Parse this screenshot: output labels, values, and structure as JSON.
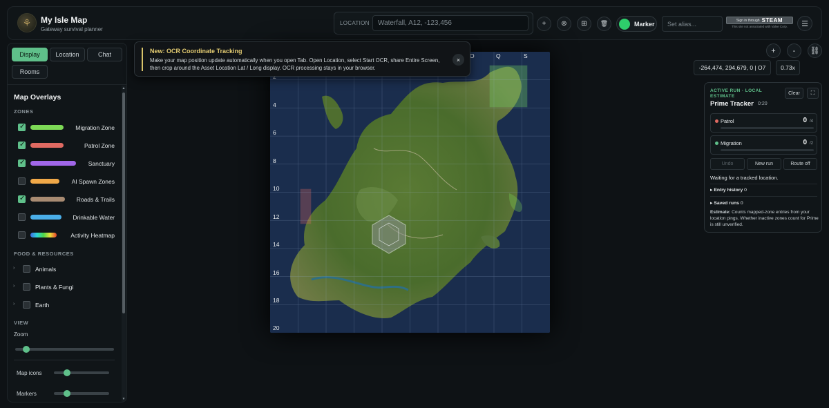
{
  "header": {
    "logo_icon": "antler-crest-icon",
    "title": "My Isle Map",
    "subtitle": "Gateway survival planner",
    "location_label": "LOCATION",
    "location_placeholder": "Waterfall, A12, -123,456",
    "buttons": {
      "add": "+",
      "ocr": "⊚",
      "grid": "⊞",
      "trash": "🗑"
    },
    "marker_label": "Marker",
    "marker_on": true,
    "alias_placeholder": "Set alias...",
    "steam_small": "Sign in through",
    "steam_big": "STEAM",
    "steam_note": "This site not associated with Valve Corp.",
    "menu_icon": "☰"
  },
  "sidebar": {
    "tabs": [
      "Display",
      "Location",
      "Chat",
      "Rooms"
    ],
    "active_tab": "Display",
    "heading": "Map Overlays",
    "zones_heading": "ZONES",
    "overlays": [
      {
        "label": "Migration Zone",
        "checked": true,
        "color": "#7dd956"
      },
      {
        "label": "Patrol Zone",
        "checked": true,
        "color": "#e06a62"
      },
      {
        "label": "Sanctuary",
        "checked": true,
        "color": "#a066e8"
      },
      {
        "label": "AI Spawn Zones",
        "checked": false,
        "color": "#f0a848"
      },
      {
        "label": "Roads & Trails",
        "checked": true,
        "color": "#a88b72"
      },
      {
        "label": "Drinkable Water",
        "checked": false,
        "color": "#4aaee8"
      },
      {
        "label": "Activity Heatmap",
        "checked": false,
        "color": "rainbow"
      }
    ],
    "food_heading": "FOOD & RESOURCES",
    "food": [
      {
        "label": "Animals",
        "checked": false
      },
      {
        "label": "Plants & Fungi",
        "checked": false
      },
      {
        "label": "Earth",
        "checked": false
      }
    ],
    "view_heading": "VIEW",
    "zoom_label": "Zoom",
    "zoom_level": 0.08,
    "map_icons_label": "Map icons",
    "map_icons_level": 0.2,
    "markers_label": "Markers",
    "markers_level": 0.2
  },
  "toast": {
    "title": "New: OCR Coordinate Tracking",
    "body": "Make your map position update automatically when you open Tab. Open Location, select Start OCR, share Entire Screen, then crop around the Asset Location Lat / Long display. OCR processing stays in your browser.",
    "close": "×"
  },
  "map": {
    "col_labels": [
      "O",
      "Q",
      "S"
    ],
    "row_labels": [
      "2",
      "4",
      "6",
      "8",
      "10",
      "12",
      "14",
      "16",
      "18",
      "20"
    ]
  },
  "controls": {
    "zoom_in": "+",
    "zoom_out": "-",
    "link_icon": "⛓",
    "coords": "-264,474, 294,679, 0 | O7",
    "zoom": "0.73x"
  },
  "tracker": {
    "tag": "ACTIVE RUN · LOCAL ESTIMATE",
    "title": "Prime Tracker",
    "time": "0:20",
    "clear": "Clear",
    "expand_icon": "⛶",
    "cards": [
      {
        "name": "Patrol",
        "count": "0",
        "max": "/4",
        "color": "#e06a62"
      },
      {
        "name": "Migration",
        "count": "0",
        "max": "/2",
        "color": "#5fc08a"
      }
    ],
    "buttons": [
      "Undo",
      "New run",
      "Route off"
    ],
    "status": "Waiting for a tracked location.",
    "entry_history": "Entry history",
    "entry_history_count": "0",
    "saved_runs": "Saved runs",
    "saved_runs_count": "0",
    "note_label": "Estimate:",
    "note": "Counts mapped-zone entries from your location pings. Whether inactive zones count for Prime is still unverified."
  }
}
